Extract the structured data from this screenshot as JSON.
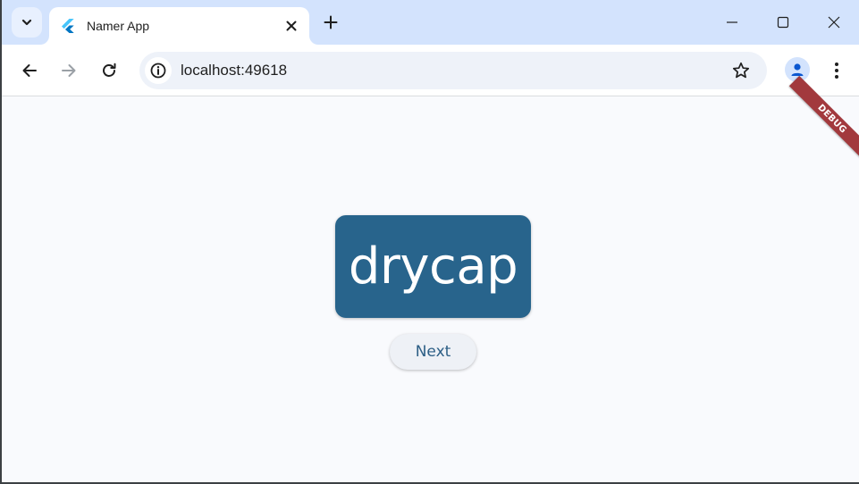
{
  "browser": {
    "tab": {
      "title": "Namer App",
      "favicon": "flutter-icon"
    },
    "address": {
      "url": "localhost:49618"
    },
    "icons": {
      "tab_search": "chevron-down-icon",
      "close_tab": "close-icon",
      "new_tab": "plus-icon",
      "minimize": "minimize-icon",
      "maximize": "maximize-icon",
      "close_window": "close-icon",
      "back": "arrow-left-icon",
      "forward": "arrow-right-icon",
      "reload": "reload-icon",
      "site_info": "info-icon",
      "bookmark": "star-icon",
      "profile": "person-icon",
      "menu": "more-vert-icon"
    },
    "colors": {
      "tabstrip": "#d3e3fd",
      "omnibox": "#eef2f9"
    }
  },
  "app": {
    "debug_banner": "DEBUG",
    "word": "drycap",
    "next_label": "Next",
    "colors": {
      "card": "#28648c",
      "button_text": "#2d5f86",
      "background": "#f9fafd",
      "debug": "#a2393d"
    }
  }
}
